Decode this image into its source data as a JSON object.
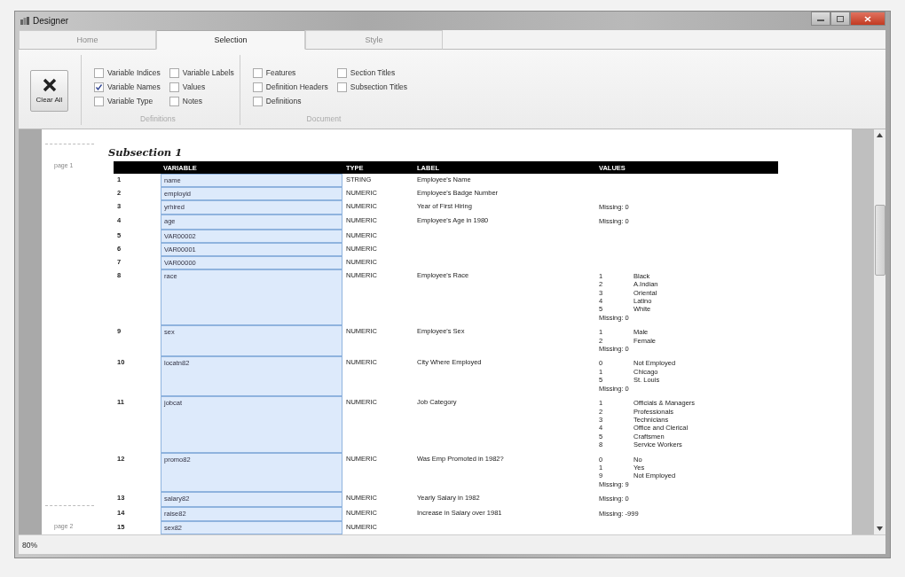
{
  "window": {
    "title": "Designer"
  },
  "tabs": [
    {
      "label": "Home",
      "selected": false
    },
    {
      "label": "Selection",
      "selected": true
    },
    {
      "label": "Style",
      "selected": false
    }
  ],
  "ribbon": {
    "clear_all_button": "Clear All",
    "groups": [
      {
        "label": "Definitions",
        "checkboxes": [
          {
            "label": "Variable Indices",
            "checked": false
          },
          {
            "label": "Variable Names",
            "checked": true
          },
          {
            "label": "Variable Type",
            "checked": false
          },
          {
            "label": "Variable Labels",
            "checked": false
          },
          {
            "label": "Values",
            "checked": false
          },
          {
            "label": "Notes",
            "checked": false
          }
        ]
      },
      {
        "label": "Document",
        "checkboxes": [
          {
            "label": "Features",
            "checked": false
          },
          {
            "label": "Definition Headers",
            "checked": false
          },
          {
            "label": "Definitions",
            "checked": false
          },
          {
            "label": "Section Titles",
            "checked": false
          },
          {
            "label": "Subsection Titles",
            "checked": false
          }
        ]
      }
    ]
  },
  "document": {
    "page_labels": [
      "page 1",
      "page 2"
    ],
    "section_title": "Subsection 1",
    "table": {
      "columns": [
        "VARIABLE",
        "TYPE",
        "LABEL",
        "VALUES"
      ],
      "rows": [
        {
          "number": "1",
          "variable": "name",
          "type": "STRING",
          "label": "Employee's Name"
        },
        {
          "number": "2",
          "variable": "employid",
          "type": "NUMERIC",
          "label": "Employee's Badge Number"
        },
        {
          "number": "3",
          "variable": "yrhired",
          "type": "NUMERIC",
          "label": "Year of First Hiring",
          "missing": "Missing:  0"
        },
        {
          "number": "4",
          "variable": "age",
          "type": "NUMERIC",
          "label": "Employee's Age in 1980",
          "missing": "Missing:  0"
        },
        {
          "number": "5",
          "variable": "VAR00002",
          "type": "NUMERIC"
        },
        {
          "number": "6",
          "variable": "VAR00001",
          "type": "NUMERIC"
        },
        {
          "number": "7",
          "variable": "VAR00000",
          "type": "NUMERIC"
        },
        {
          "number": "8",
          "variable": "race",
          "type": "NUMERIC",
          "label": "Employee's Race",
          "values": [
            {
              "code": "1",
              "label": "Black"
            },
            {
              "code": "2",
              "label": "A.Indian"
            },
            {
              "code": "3",
              "label": "Oriental"
            },
            {
              "code": "4",
              "label": "Latino"
            },
            {
              "code": "5",
              "label": "White"
            }
          ],
          "missing": "Missing:  0"
        },
        {
          "number": "9",
          "variable": "sex",
          "type": "NUMERIC",
          "label": "Employee's Sex",
          "values": [
            {
              "code": "1",
              "label": "Male"
            },
            {
              "code": "2",
              "label": "Female"
            }
          ],
          "missing": "Missing:  0"
        },
        {
          "number": "10",
          "variable": "locatn82",
          "type": "NUMERIC",
          "label": "City Where Employed",
          "values": [
            {
              "code": "0",
              "label": "Not Employed"
            },
            {
              "code": "1",
              "label": "Chicago"
            },
            {
              "code": "5",
              "label": "St. Louis"
            }
          ],
          "missing": "Missing:  0"
        },
        {
          "number": "11",
          "variable": "jobcat",
          "type": "NUMERIC",
          "label": "Job Category",
          "values": [
            {
              "code": "1",
              "label": "Officials & Managers"
            },
            {
              "code": "2",
              "label": "Professionals"
            },
            {
              "code": "3",
              "label": "Technicians"
            },
            {
              "code": "4",
              "label": "Office and Clerical"
            },
            {
              "code": "5",
              "label": "Craftsmen"
            },
            {
              "code": "8",
              "label": "Service Workers"
            }
          ]
        },
        {
          "number": "12",
          "variable": "promo82",
          "type": "NUMERIC",
          "label": "Was Emp Promoted in 1982?",
          "values": [
            {
              "code": "0",
              "label": "No"
            },
            {
              "code": "1",
              "label": "Yes"
            },
            {
              "code": "9",
              "label": "Not Employed"
            }
          ],
          "missing": "Missing:  9"
        },
        {
          "number": "13",
          "variable": "salary82",
          "type": "NUMERIC",
          "label": "Yearly Salary in 1982",
          "missing": "Missing:  0"
        },
        {
          "number": "14",
          "variable": "raise82",
          "type": "NUMERIC",
          "label": "Increase in Salary over 1981",
          "missing": "Missing:  -999"
        },
        {
          "number": "15",
          "variable": "sex82",
          "type": "NUMERIC"
        }
      ]
    }
  },
  "status_bar": {
    "zoom": "80%"
  }
}
